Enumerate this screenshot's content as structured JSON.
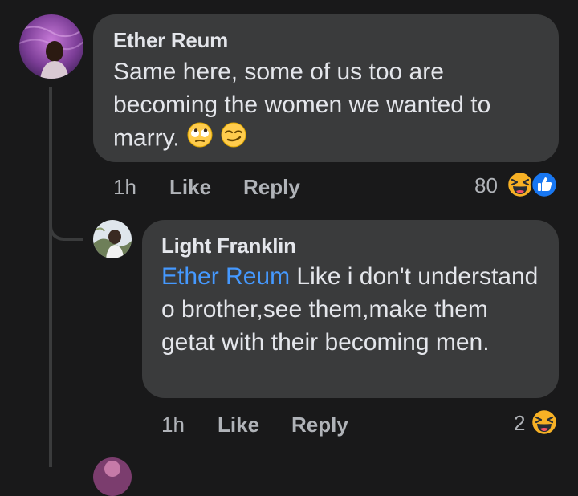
{
  "comments": [
    {
      "author": "Ether Reum",
      "text": "Same here, some of us too are becoming the women we wanted to marry.",
      "emojis": [
        "face-with-rolling-eyes-icon",
        "smirking-face-icon"
      ],
      "time": "1h",
      "like_label": "Like",
      "reply_label": "Reply",
      "reaction_count": "80",
      "reactions": [
        "haha-reaction-icon",
        "like-reaction-icon"
      ]
    },
    {
      "author": "Light Franklin",
      "mention": "Ether Reum",
      "text": " Like i don't understand o brother,see them,make them getat with their becoming men.",
      "time": "1h",
      "like_label": "Like",
      "reply_label": "Reply",
      "reaction_count": "2",
      "reactions": [
        "haha-reaction-icon"
      ]
    }
  ],
  "colors": {
    "background": "#19191a",
    "bubble": "#3a3b3c",
    "text": "#e4e6eb",
    "secondary_text": "#b0b3b8",
    "mention": "#4599ff",
    "like_blue": "#1877f2",
    "haha_yellow": "#f7b125"
  }
}
